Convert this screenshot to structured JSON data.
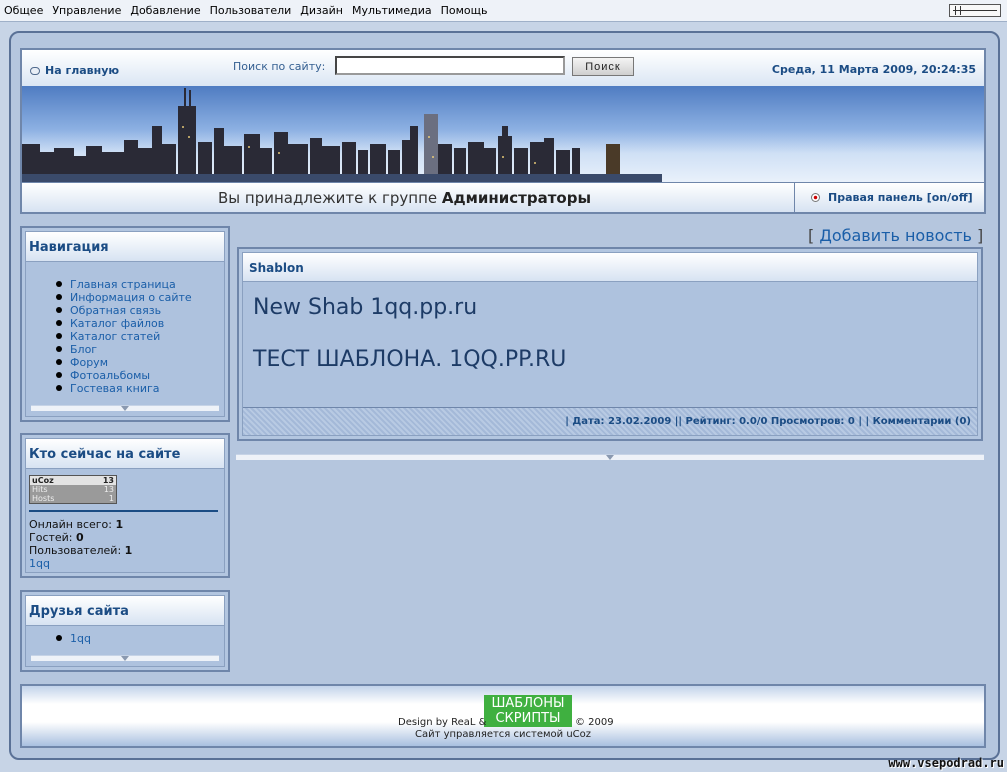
{
  "admin_menu": [
    "Общее",
    "Управление",
    "Добавление",
    "Пользователи",
    "Дизайн",
    "Мультимедиа",
    "Помощь"
  ],
  "header": {
    "home_link": "На главную",
    "search_label": "Поиск по сайту:",
    "search_value": "",
    "search_button": "Поиск",
    "date": "Среда, 11 Марта 2009, 20:24:35",
    "group_prefix": "Вы принадлежите к группе ",
    "group_name": "Администраторы",
    "right_panel_toggle": "Правая панель [on/off]"
  },
  "navigation": {
    "title": "Навигация",
    "items": [
      "Главная страница",
      "Информация о сайте",
      "Обратная связь",
      "Каталог файлов",
      "Каталог статей",
      "Блог",
      "Форум",
      "Фотоальбомы",
      "Гостевая книга"
    ]
  },
  "online": {
    "title": "Кто сейчас на сайте",
    "counter": {
      "brand": "uCoz",
      "brand_value": "13",
      "hits_label": "Hits",
      "hits_value": "13",
      "hosts_label": "Hosts",
      "hosts_value": "1"
    },
    "total_label": "Онлайн всего: ",
    "total_value": "1",
    "guests_label": "Гостей: ",
    "guests_value": "0",
    "users_label": "Пользователей: ",
    "users_value": "1",
    "user_link": "1qq"
  },
  "friends": {
    "title": "Друзья сайта",
    "items": [
      "1qq"
    ]
  },
  "main": {
    "add_news_open": "[ ",
    "add_news": "Добавить новость",
    "add_news_close": " ]",
    "post_title": "Shablon",
    "post_line1": "New Shab 1qq.pp.ru",
    "post_line2": "ТЕСТ ШАБЛОНА. 1QQ.PP.RU",
    "post_meta": "| Дата: 23.02.2009 || Рейтинг: 0.0/0 Просмотров: 0 | | Комментарии (0)"
  },
  "footer": {
    "badge_line1": "ШАБЛОНЫ",
    "badge_line2": "СКРИПТЫ",
    "design": "Design by ReaL &",
    "year": "© 2009",
    "ucoz": "Сайт управляется системой uCoz"
  },
  "watermark": "www.vsepodrad.ru",
  "colors": {
    "accent": "#1b4c84",
    "link": "#1a5ea8",
    "frame": "#6f86aa",
    "block_bg": "#aec2de",
    "badge": "#3fb040"
  }
}
